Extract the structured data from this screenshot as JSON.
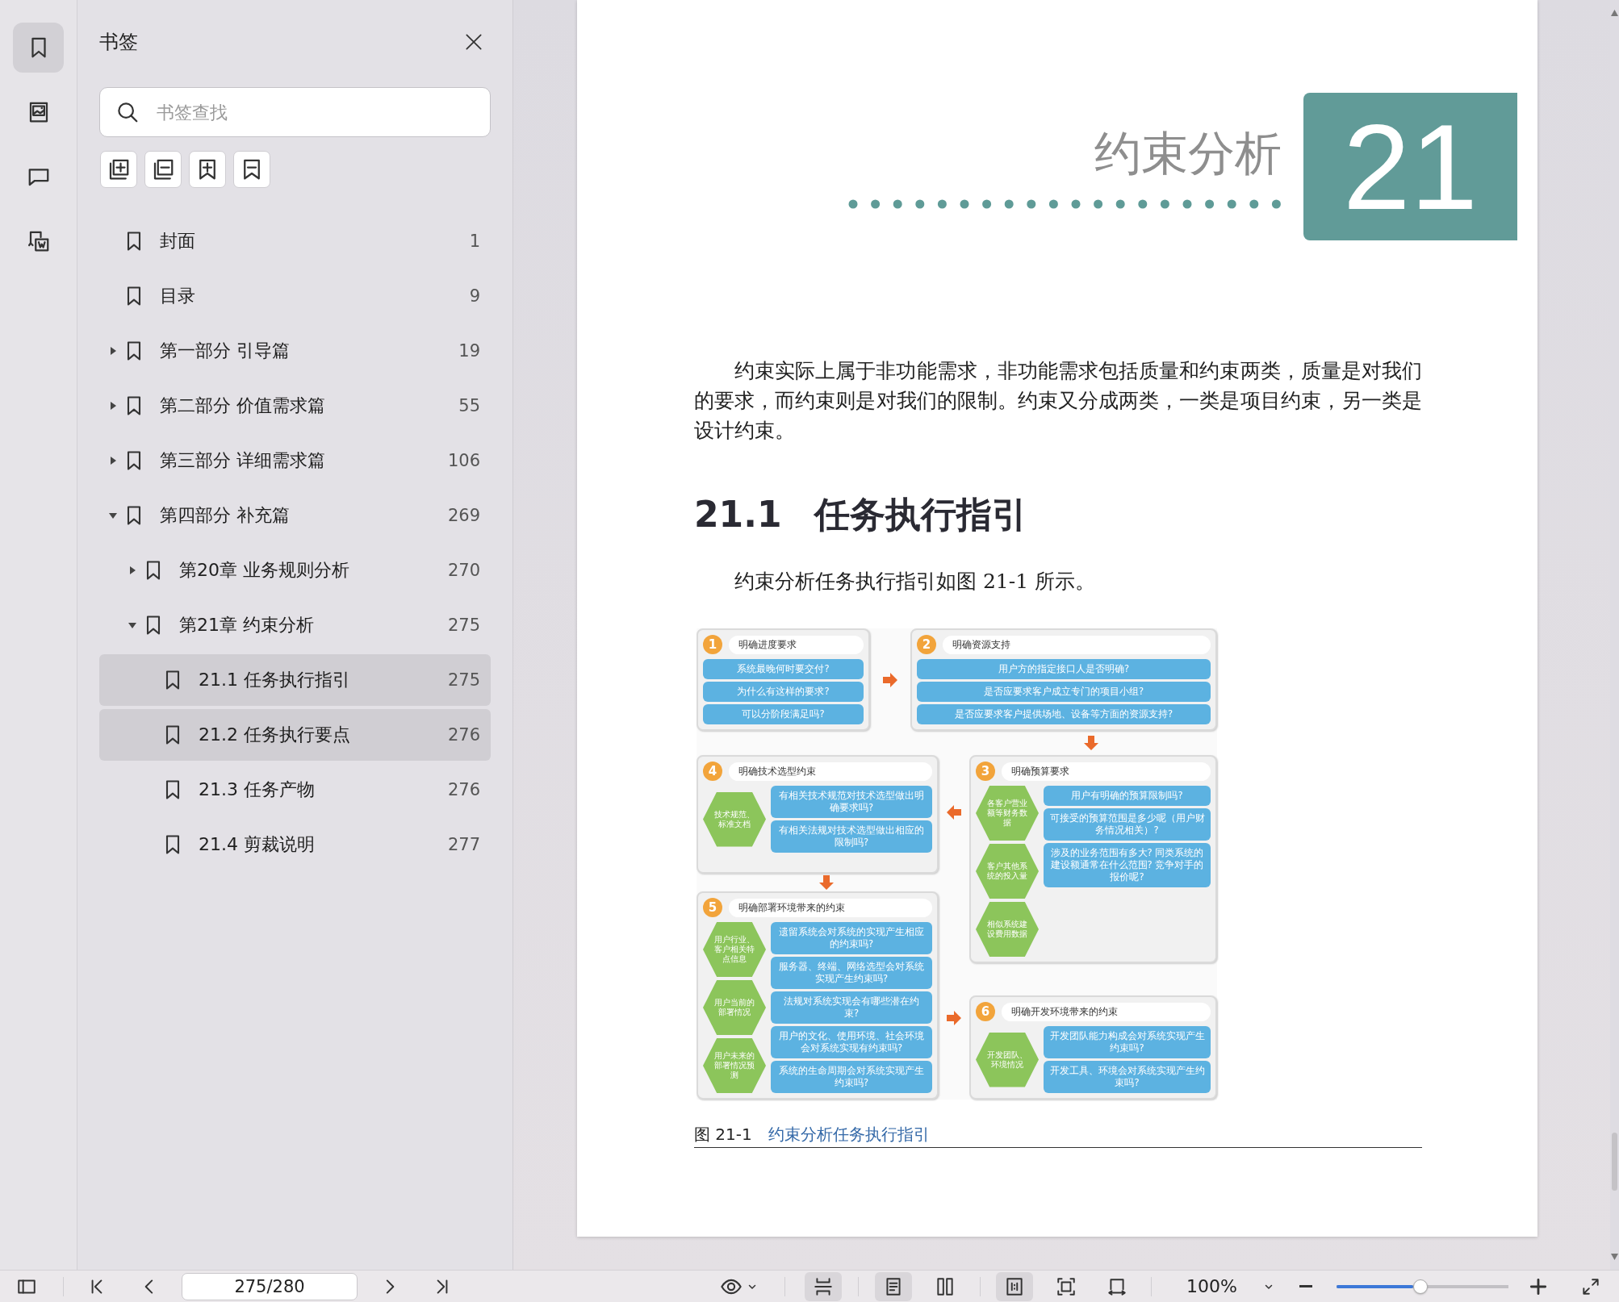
{
  "rail": {
    "tabs": [
      {
        "kind": "bookmarks",
        "selected": true
      },
      {
        "kind": "thumbnails",
        "selected": false
      },
      {
        "kind": "comments",
        "selected": false
      },
      {
        "kind": "convert",
        "selected": false
      }
    ]
  },
  "sidebar": {
    "title": "书签",
    "search": {
      "placeholder": "书签查找"
    },
    "bookmarks": [
      {
        "label": "封面",
        "page": "1",
        "selected": false
      },
      {
        "label": "目录",
        "page": "9",
        "selected": false
      },
      {
        "label": "第一部分 引导篇",
        "page": "19",
        "expanded": false,
        "selected": false
      },
      {
        "label": "第二部分 价值需求篇",
        "page": "55",
        "expanded": false,
        "selected": false
      },
      {
        "label": "第三部分 详细需求篇",
        "page": "106",
        "expanded": false,
        "selected": false
      },
      {
        "label": "第四部分 补充篇",
        "page": "269",
        "expanded": true,
        "selected": false,
        "children": [
          {
            "label": "第20章 业务规则分析",
            "page": "270",
            "expanded": false,
            "selected": false
          },
          {
            "label": "第21章 约束分析",
            "page": "275",
            "expanded": true,
            "selected": false,
            "children": [
              {
                "label": "21.1 任务执行指引",
                "page": "275",
                "selected": true
              },
              {
                "label": "21.2 任务执行要点",
                "page": "276",
                "selected": true
              },
              {
                "label": "21.3 任务产物",
                "page": "276",
                "selected": false
              },
              {
                "label": "21.4 剪裁说明",
                "page": "277",
                "selected": false
              }
            ]
          }
        ]
      }
    ]
  },
  "page": {
    "chapter": {
      "title": "约束分析",
      "number": "21"
    },
    "paragraph": "约束实际上属于非功能需求，非功能需求包括质量和约束两类，质量是对我们的要求，而约束则是对我们的限制。约束又分成两类，一类是项目约束，另一类是设计约束。",
    "section": {
      "number": "21.1",
      "title": "任务执行指引"
    },
    "intro": "约束分析任务执行指引如图 21-1 所示。",
    "figure": {
      "panels": [
        {
          "number": "1",
          "title": "明确进度要求",
          "questions": [
            "系统最晚何时要交付?",
            "为什么有这样的要求?",
            "可以分阶段满足吗?"
          ]
        },
        {
          "number": "2",
          "title": "明确资源支持",
          "questions": [
            "用户方的指定接口人是否明确?",
            "是否应要求客户成立专门的项目小组?",
            "是否应要求客户提供场地、设备等方面的资源支持?"
          ]
        },
        {
          "number": "4",
          "title": "明确技术选型约束",
          "hexes": [
            "技术规范、标准文档"
          ],
          "questions": [
            "有相关技术规范对技术选型做出明确要求吗?",
            "有相关法规对技术选型做出相应的限制吗?"
          ]
        },
        {
          "number": "3",
          "title": "明确预算要求",
          "hexes": [
            "各客户营业额等财务数据",
            "客户其他系统的投入量",
            "相似系统建设费用数据"
          ],
          "questions": [
            "用户有明确的预算限制吗?",
            "可接受的预算范围是多少呢（用户财务情况相关）?",
            "涉及的业务范围有多大? 同类系统的建设额通常在什么范围? 竞争对手的报价呢?"
          ]
        },
        {
          "number": "5",
          "title": "明确部署环境带来的约束",
          "hexes": [
            "用户行业、客户相关特点信息",
            "用户当前的部署情况",
            "用户未来的部署情况预测"
          ],
          "questions": [
            "遗留系统会对系统的实现产生相应的约束吗?",
            "服务器、终端、网络选型会对系统实现产生约束吗?",
            "法规对系统实现会有哪些潜在约束?",
            "用户的文化、使用环境、社会环境会对系统实现有约束吗?",
            "系统的生命周期会对系统实现产生约束吗?"
          ]
        },
        {
          "number": "6",
          "title": "明确开发环境带来的约束",
          "hexes": [
            "开发团队、环境情况"
          ],
          "questions": [
            "开发团队能力构成会对系统实现产生约束吗?",
            "开发工具、环境会对系统实现产生约束吗?"
          ]
        }
      ]
    },
    "caption": {
      "label": "图 21-1",
      "title": "约束分析任务执行指引"
    }
  },
  "toolbar": {
    "page_field": {
      "value": "275/280"
    },
    "view_modes": [
      {
        "kind": "continuous",
        "selected": true
      }
    ],
    "page_modes": [
      {
        "kind": "single",
        "selected": true
      },
      {
        "kind": "double",
        "selected": false
      }
    ],
    "fit_modes": [
      {
        "kind": "actual",
        "selected": true
      },
      {
        "kind": "page",
        "selected": false
      },
      {
        "kind": "width",
        "selected": false
      }
    ],
    "zoom": {
      "value": "100%",
      "level": 0.49
    }
  }
}
